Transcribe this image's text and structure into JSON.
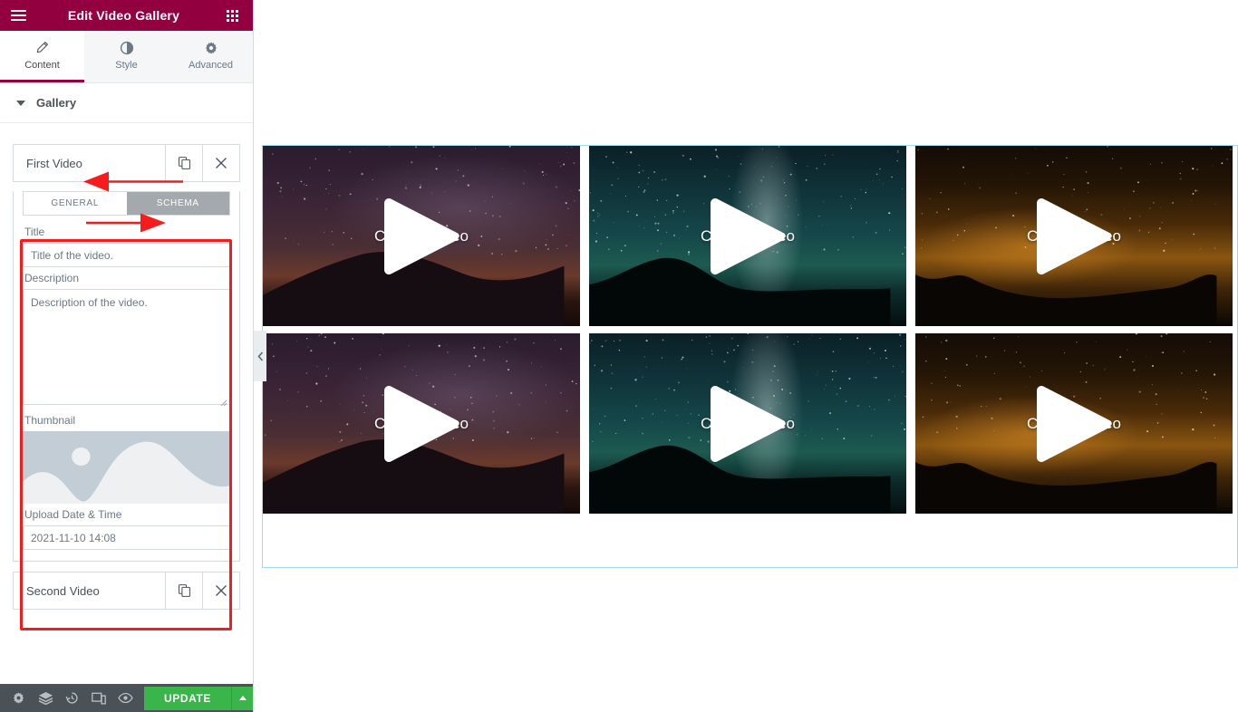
{
  "panel": {
    "header": {
      "title": "Edit Video Gallery",
      "menu_icon": "hamburger-menu-icon",
      "grid_icon": "apps-grid-icon",
      "background": "#93003f"
    },
    "tabs": [
      {
        "label": "Content",
        "icon": "pencil-icon",
        "active": true
      },
      {
        "label": "Style",
        "icon": "contrast-icon",
        "active": false
      },
      {
        "label": "Advanced",
        "icon": "gear-icon",
        "active": false
      }
    ],
    "section": {
      "label": "Gallery",
      "expanded": true,
      "caret_icon": "caret-down-icon"
    },
    "repeater": {
      "first": {
        "title": "First Video",
        "duplicate_icon": "duplicate-icon",
        "remove_icon": "close-icon"
      },
      "second": {
        "title": "Second Video",
        "duplicate_icon": "duplicate-icon",
        "remove_icon": "close-icon"
      }
    },
    "subtabs": [
      {
        "label": "GENERAL",
        "active": false
      },
      {
        "label": "SCHEMA",
        "active": true
      }
    ],
    "fields": {
      "title": {
        "label": "Title",
        "value": "Title of the video."
      },
      "description": {
        "label": "Description",
        "value": "Description of the video."
      },
      "thumbnail": {
        "label": "Thumbnail",
        "placeholder_icon": "image-placeholder-icon"
      },
      "upload_datetime": {
        "label": "Upload Date & Time",
        "value": "2021-11-10 14:08"
      }
    },
    "footer": {
      "icons": [
        {
          "name": "settings-gear-icon"
        },
        {
          "name": "navigator-layers-icon"
        },
        {
          "name": "history-clock-icon"
        },
        {
          "name": "responsive-mode-icon"
        },
        {
          "name": "preview-eye-icon"
        }
      ],
      "update_label": "UPDATE",
      "update_color": "#39b54a",
      "caret_icon": "caret-up-icon"
    }
  },
  "annotations": {
    "highlight_color": "#f41c1c",
    "arrows": [
      {
        "name": "arrow-to-first-video",
        "direction": "left"
      },
      {
        "name": "arrow-to-schema-tab",
        "direction": "right"
      }
    ],
    "highlight_box": {
      "name": "schema-fields-highlight"
    }
  },
  "canvas": {
    "collapse_handle_icon": "chevron-left-icon",
    "selection_color": "#9fdcf0",
    "videos": [
      {
        "label": "Choose video",
        "theme": "purple-mountain-night",
        "play_icon": "play-icon"
      },
      {
        "label": "Choose video",
        "theme": "teal-milkyway-lake",
        "play_icon": "play-icon"
      },
      {
        "label": "Choose video",
        "theme": "amber-night-trees",
        "play_icon": "play-icon"
      },
      {
        "label": "Choose video",
        "theme": "purple-mountain-night",
        "play_icon": "play-icon"
      },
      {
        "label": "Choose video",
        "theme": "teal-milkyway-lake",
        "play_icon": "play-icon"
      },
      {
        "label": "Choose video",
        "theme": "amber-night-trees",
        "play_icon": "play-icon"
      }
    ]
  }
}
